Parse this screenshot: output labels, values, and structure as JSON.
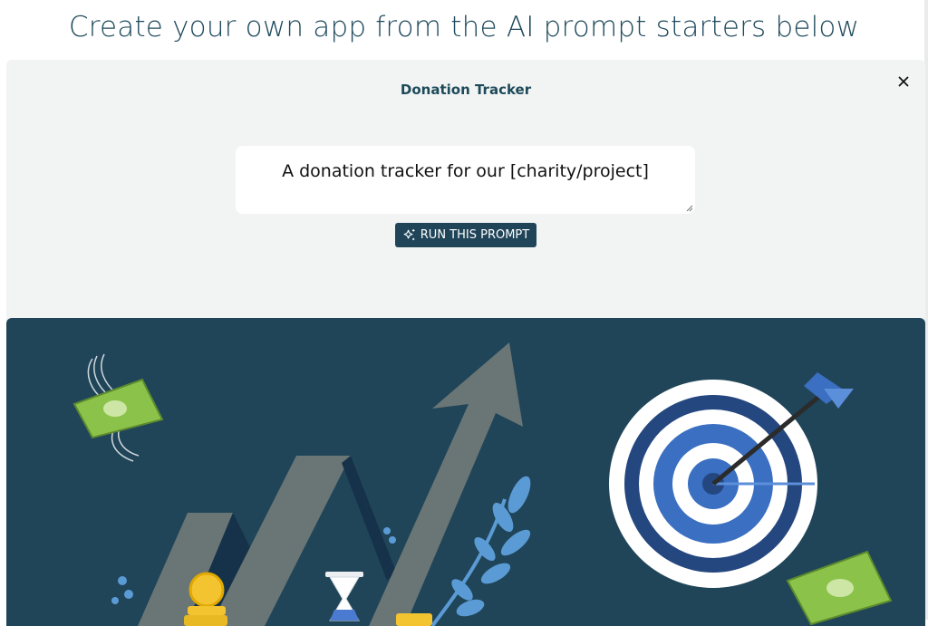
{
  "page": {
    "heading": "Create your own app from the AI prompt starters below"
  },
  "prompt_card": {
    "title": "Donation Tracker",
    "prompt_text": "A donation tracker for our [charity/project]",
    "run_button_label": "RUN THIS PROMPT",
    "close_icon": "close-icon",
    "run_icon": "sparkle-icon"
  },
  "hero_illustration": {
    "description_icons": [
      "winged-money-icon",
      "growth-arrow-icon",
      "target-icon",
      "hourglass-icon",
      "coins-icon",
      "money-bill-icon",
      "leaf-icon"
    ]
  },
  "colors": {
    "heading": "#1f4a5c",
    "panel_bg": "#f2f4f3",
    "button_bg": "#204559",
    "hero_bg": "#204559",
    "arrow": "#6a7675",
    "target_blue": "#3a6fc1",
    "money_green": "#8bc34a",
    "coin_yellow": "#f4c430"
  }
}
